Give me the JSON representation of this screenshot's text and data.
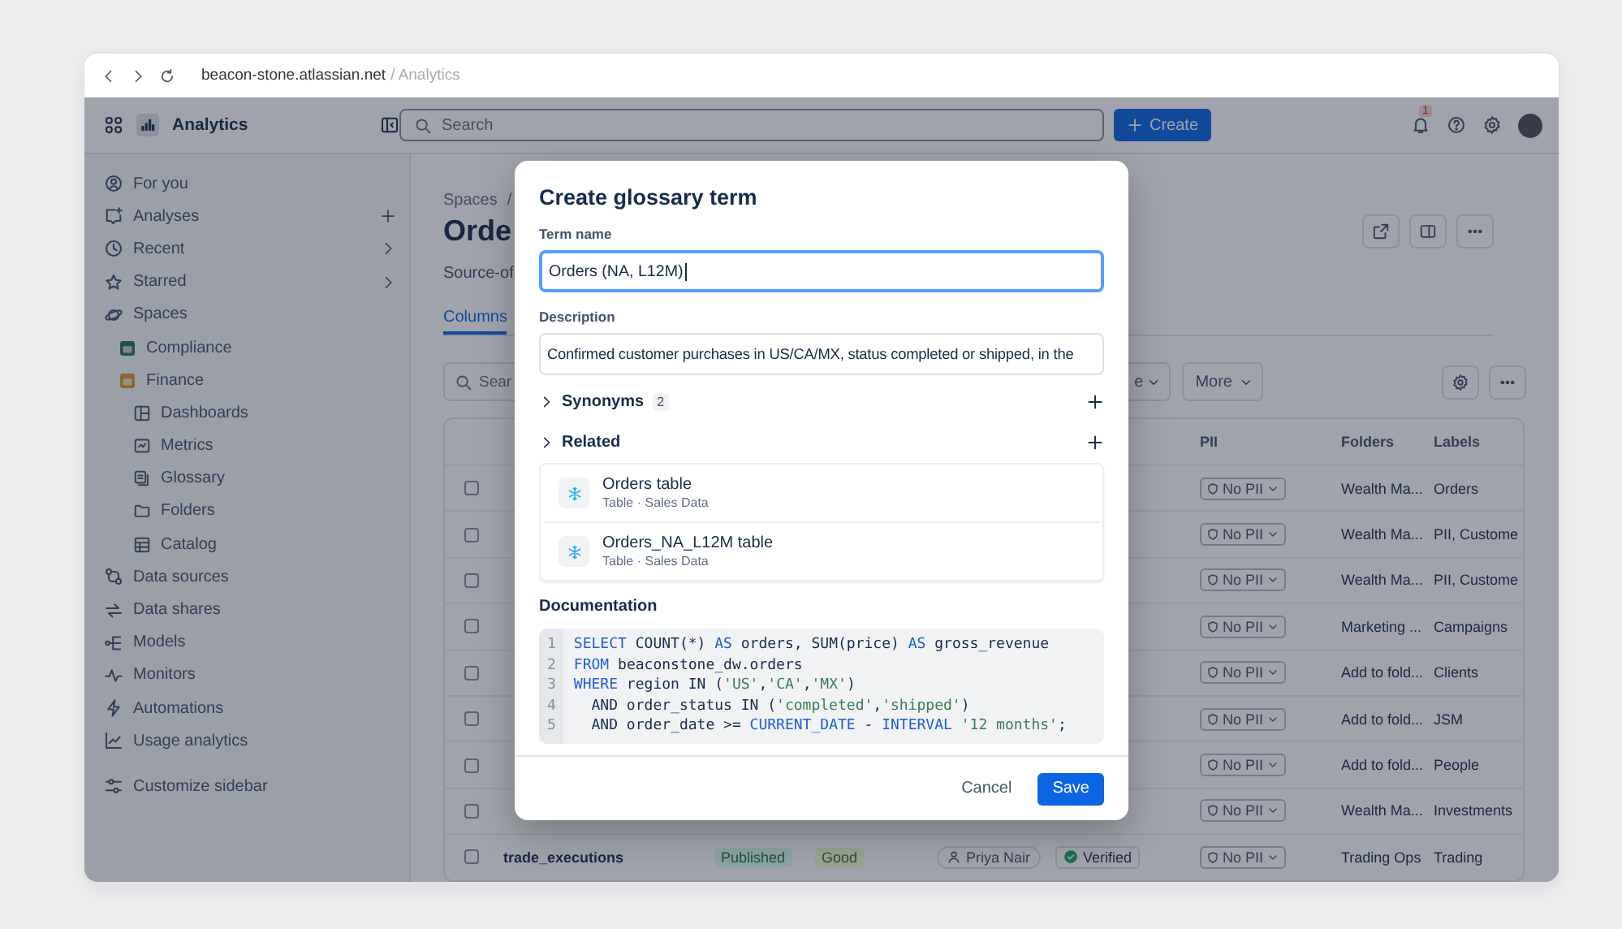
{
  "browser": {
    "host": "beacon-stone.atlassian.net",
    "path": "/ Analytics"
  },
  "app": {
    "name": "Analytics"
  },
  "topbar": {
    "search_placeholder": "Search",
    "create_label": "Create",
    "notification_count": "1"
  },
  "sidebar": {
    "items": [
      {
        "label": "For you",
        "kind": "link"
      },
      {
        "label": "Analyses",
        "kind": "add"
      },
      {
        "label": "Recent",
        "kind": "submenu"
      },
      {
        "label": "Starred",
        "kind": "submenu"
      },
      {
        "label": "Spaces",
        "kind": "link",
        "children": [
          {
            "label": "Compliance"
          },
          {
            "label": "Finance",
            "children": [
              {
                "label": "Dashboards"
              },
              {
                "label": "Metrics"
              },
              {
                "label": "Glossary"
              },
              {
                "label": "Folders"
              },
              {
                "label": "Catalog"
              }
            ]
          }
        ]
      },
      {
        "label": "Data sources",
        "kind": "link"
      },
      {
        "label": "Data shares",
        "kind": "link"
      },
      {
        "label": "Models",
        "kind": "link"
      },
      {
        "label": "Monitors",
        "kind": "link"
      },
      {
        "label": "Automations",
        "kind": "link"
      },
      {
        "label": "Usage analytics",
        "kind": "link"
      }
    ],
    "footer": "Customize sidebar"
  },
  "page": {
    "breadcrumb": "Spaces",
    "breadcrumb_separator": "/",
    "title": "Orde",
    "subtitle": "Source-of",
    "tabs": [
      {
        "label": "Columns",
        "selected": true
      }
    ],
    "filter_search": "Sear",
    "filters": [
      {
        "label": "e"
      },
      {
        "label": "More"
      }
    ],
    "table": {
      "columns": [
        {
          "label": "PII"
        },
        {
          "label": "Folders"
        },
        {
          "label": "Labels"
        }
      ],
      "rows": [
        {
          "checked": false,
          "pii": "No PII",
          "folders": "Wealth Ma...",
          "labels": "Orders"
        },
        {
          "checked": false,
          "pii": "No PII",
          "folders": "Wealth Ma...",
          "labels": "PII, Custome"
        },
        {
          "checked": false,
          "pii": "No PII",
          "folders": "Wealth Ma...",
          "labels": "PII, Custome"
        },
        {
          "checked": false,
          "pii": "No PII",
          "folders": "Marketing ...",
          "labels": "Campaigns"
        },
        {
          "checked": false,
          "pii": "No PII",
          "folders": "Add to fold...",
          "labels": "Clients"
        },
        {
          "checked": false,
          "pii": "No PII",
          "folders": "Add to fold...",
          "labels": "JSM"
        },
        {
          "checked": false,
          "pii": "No PII",
          "folders": "Add to fold...",
          "labels": "People"
        },
        {
          "checked": false,
          "pii": "No PII",
          "folders": "Wealth Ma...",
          "labels": "Investments"
        },
        {
          "checked": false,
          "name": "trade_executions",
          "status": "Published",
          "quality": "Good",
          "owner": "Priya Nair",
          "verification": "Verified",
          "pii": "No PII",
          "folders": "Trading Ops",
          "labels": "Trading"
        }
      ]
    }
  },
  "dialog": {
    "title": "Create glossary term",
    "term_label": "Term name",
    "term_value": "Orders (NA, L12M)",
    "description_label": "Description",
    "description_value": "Confirmed customer purchases in US/CA/MX, status completed or shipped, in the",
    "sections": [
      {
        "label": "Synonyms",
        "count": "2",
        "expanded": false
      },
      {
        "label": "Related",
        "expanded": false
      }
    ],
    "related": [
      {
        "title": "Orders table",
        "meta": "Table · Sales Data"
      },
      {
        "title": "Orders_NA_L12M table",
        "meta": "Table · Sales Data"
      }
    ],
    "documentation_label": "Documentation",
    "code": [
      {
        "number": "1",
        "tokens": [
          {
            "kind": "keyword",
            "t": "SELECT"
          },
          {
            "kind": "plain",
            "t": " COUNT(*) "
          },
          {
            "kind": "keyword",
            "t": "AS"
          },
          {
            "kind": "plain",
            "t": " orders, SUM(price) "
          },
          {
            "kind": "keyword",
            "t": "AS"
          },
          {
            "kind": "plain",
            "t": " gross_revenue"
          }
        ]
      },
      {
        "number": "2",
        "tokens": [
          {
            "kind": "keyword",
            "t": "FROM"
          },
          {
            "kind": "plain",
            "t": " beaconstone_dw.orders"
          }
        ]
      },
      {
        "number": "3",
        "tokens": [
          {
            "kind": "keyword",
            "t": "WHERE"
          },
          {
            "kind": "plain",
            "t": " region IN ("
          },
          {
            "kind": "string",
            "t": "'US'"
          },
          {
            "kind": "plain",
            "t": ","
          },
          {
            "kind": "string",
            "t": "'CA'"
          },
          {
            "kind": "plain",
            "t": ","
          },
          {
            "kind": "string",
            "t": "'MX'"
          },
          {
            "kind": "plain",
            "t": ")"
          }
        ]
      },
      {
        "number": "4",
        "tokens": [
          {
            "kind": "plain",
            "t": "  AND order_status IN ("
          },
          {
            "kind": "string",
            "t": "'completed'"
          },
          {
            "kind": "plain",
            "t": ","
          },
          {
            "kind": "string",
            "t": "'shipped'"
          },
          {
            "kind": "plain",
            "t": ")"
          }
        ]
      },
      {
        "number": "5",
        "tokens": [
          {
            "kind": "plain",
            "t": "  AND order_date >= "
          },
          {
            "kind": "keyword",
            "t": "CURRENT_DATE"
          },
          {
            "kind": "plain",
            "t": " - "
          },
          {
            "kind": "keyword",
            "t": "INTERVAL"
          },
          {
            "kind": "string",
            "t": " '12 months'"
          },
          {
            "kind": "plain",
            "t": ";"
          }
        ]
      }
    ],
    "cancel_label": "Cancel",
    "save_label": "Save"
  }
}
